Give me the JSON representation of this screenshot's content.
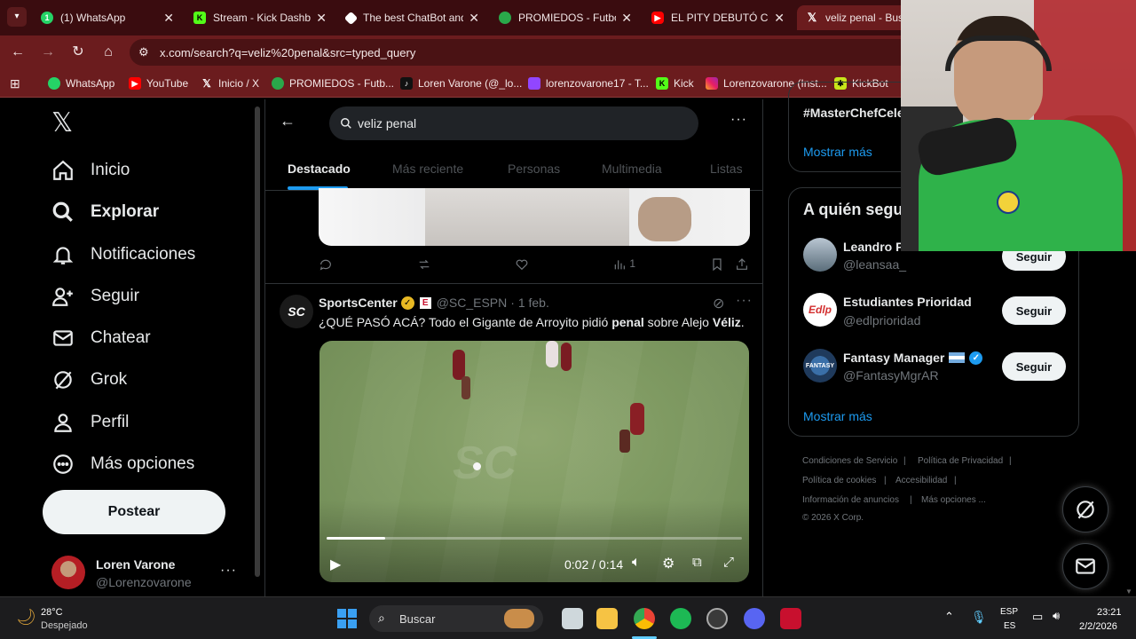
{
  "browser": {
    "tabs": [
      {
        "title": "(1) WhatsApp",
        "icon": "whatsapp-icon",
        "badge": "1",
        "color": "#25d366"
      },
      {
        "title": "Stream - Kick Dashbo",
        "icon": "kick-icon",
        "color": "#53fc18"
      },
      {
        "title": "The best ChatBot and",
        "icon": "chatbot-icon",
        "color": "#ffffff"
      },
      {
        "title": "PROMIEDOS - Futbol",
        "icon": "promiedos-icon",
        "color": "#2aa84a"
      },
      {
        "title": "EL PITY DEBUTÓ CON",
        "icon": "youtube-icon",
        "color": "#ff0000"
      },
      {
        "title": "veliz penal - Busq",
        "icon": "x-icon",
        "color": "#000000"
      }
    ],
    "url": "x.com/search?q=veliz%20penal&src=typed_query",
    "bookmarks": [
      {
        "label": "WhatsApp",
        "icon": "whatsapp-icon"
      },
      {
        "label": "YouTube",
        "icon": "youtube-icon"
      },
      {
        "label": "Inicio / X",
        "icon": "x-icon"
      },
      {
        "label": "PROMIEDOS - Futb...",
        "icon": "promiedos-icon"
      },
      {
        "label": "Loren Varone (@_lo...",
        "icon": "tiktok-icon"
      },
      {
        "label": "lorenzovarone17 - T...",
        "icon": "twitch-icon"
      },
      {
        "label": "Kick",
        "icon": "kick-icon"
      },
      {
        "label": "Lorenzovarone (Inst...",
        "icon": "instagram-icon"
      },
      {
        "label": "KickBot",
        "icon": "kickbot-icon"
      }
    ]
  },
  "nav": {
    "items": [
      {
        "label": "Inicio",
        "icon": "home-icon"
      },
      {
        "label": "Explorar",
        "icon": "search-icon"
      },
      {
        "label": "Notificaciones",
        "icon": "bell-icon"
      },
      {
        "label": "Seguir",
        "icon": "follow-icon"
      },
      {
        "label": "Chatear",
        "icon": "mail-icon"
      },
      {
        "label": "Grok",
        "icon": "grok-icon"
      },
      {
        "label": "Perfil",
        "icon": "profile-icon"
      },
      {
        "label": "Más opciones",
        "icon": "more-icon"
      }
    ],
    "post_label": "Postear",
    "profile": {
      "name": "Loren Varone",
      "handle": "@Lorenzovarone"
    }
  },
  "search": {
    "query": "veliz penal",
    "tabs": [
      "Destacado",
      "Más reciente",
      "Personas",
      "Multimedia",
      "Listas"
    ],
    "active_tab": "Destacado"
  },
  "prev_post": {
    "views": "1"
  },
  "post": {
    "author": "SportsCenter",
    "handle": "@SC_ESPN",
    "date": "· 1 feb.",
    "text_a": "¿QUÉ PASÓ ACÁ? Todo el Gigante de Arroyito pidió ",
    "text_b": "penal",
    "text_c": " sobre Alejo ",
    "text_d": "Véliz",
    "text_e": ".",
    "video": {
      "time": "0:02 / 0:14",
      "watermark": "SC",
      "progress": 0.14
    }
  },
  "right": {
    "trend": "#MasterChefCele",
    "show_more_1": "Mostrar más",
    "who_to_follow_title": "A quién seguir",
    "follow_label": "Seguir",
    "suggestions": [
      {
        "name": "Leandro P",
        "handle": "@leansaa_",
        "color": "#5a6d7a"
      },
      {
        "name": "Estudiantes Prioridad",
        "handle": "@edlprioridad",
        "color": "#ffffff"
      },
      {
        "name": "Fantasy Manager",
        "handle": "@FantasyMgrAR",
        "color": "#1f3a5c"
      }
    ],
    "show_more_2": "Mostrar más",
    "footer": [
      "Condiciones de Servicio",
      "Política de Privacidad",
      "Política de cookies",
      "Accesibilidad",
      "Información de anuncios",
      "Más opciones ...",
      "© 2026 X Corp."
    ]
  },
  "taskbar": {
    "weather_temp": "28°C",
    "weather_desc": "Despejado",
    "search_label": "Buscar",
    "lang_top": "ESP",
    "lang_bottom": "ES",
    "time": "23:21",
    "date": "2/2/2026"
  },
  "colors": {
    "accent": "#1d9bf0",
    "chrome": "#6b1c1e",
    "verified_gold": "#e8b923"
  }
}
